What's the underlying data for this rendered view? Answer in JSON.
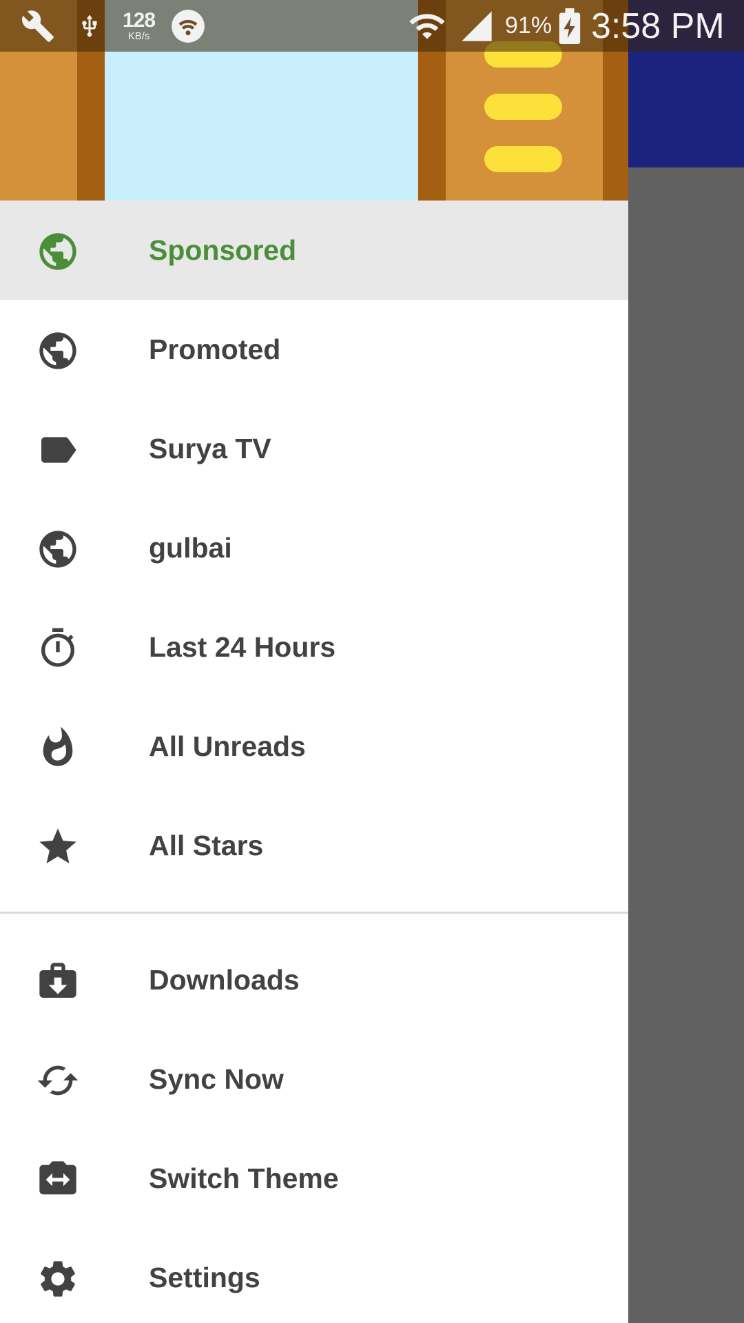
{
  "status_bar": {
    "network_speed_value": "128",
    "network_speed_unit": "KB/s",
    "battery_percent": "91%",
    "time": "3:58 PM"
  },
  "colors": {
    "selected_accent": "#4B8E3A",
    "toolbar": "#1A237E",
    "icon": "#424242"
  },
  "drawer": {
    "primary_items": [
      {
        "label": "Sponsored",
        "icon": "globe-icon",
        "selected": true
      },
      {
        "label": "Promoted",
        "icon": "globe-icon",
        "selected": false
      },
      {
        "label": "Surya TV",
        "icon": "label-tag-icon",
        "selected": false
      },
      {
        "label": "gulbai",
        "icon": "globe-icon",
        "selected": false
      },
      {
        "label": "Last 24 Hours",
        "icon": "timer-icon",
        "selected": false
      },
      {
        "label": "All Unreads",
        "icon": "flame-icon",
        "selected": false
      },
      {
        "label": "All Stars",
        "icon": "star-icon",
        "selected": false
      }
    ],
    "secondary_items": [
      {
        "label": "Downloads",
        "icon": "downloads-icon"
      },
      {
        "label": "Sync Now",
        "icon": "sync-icon"
      },
      {
        "label": "Switch Theme",
        "icon": "switch-theme-icon"
      },
      {
        "label": "Settings",
        "icon": "gear-icon"
      }
    ]
  }
}
